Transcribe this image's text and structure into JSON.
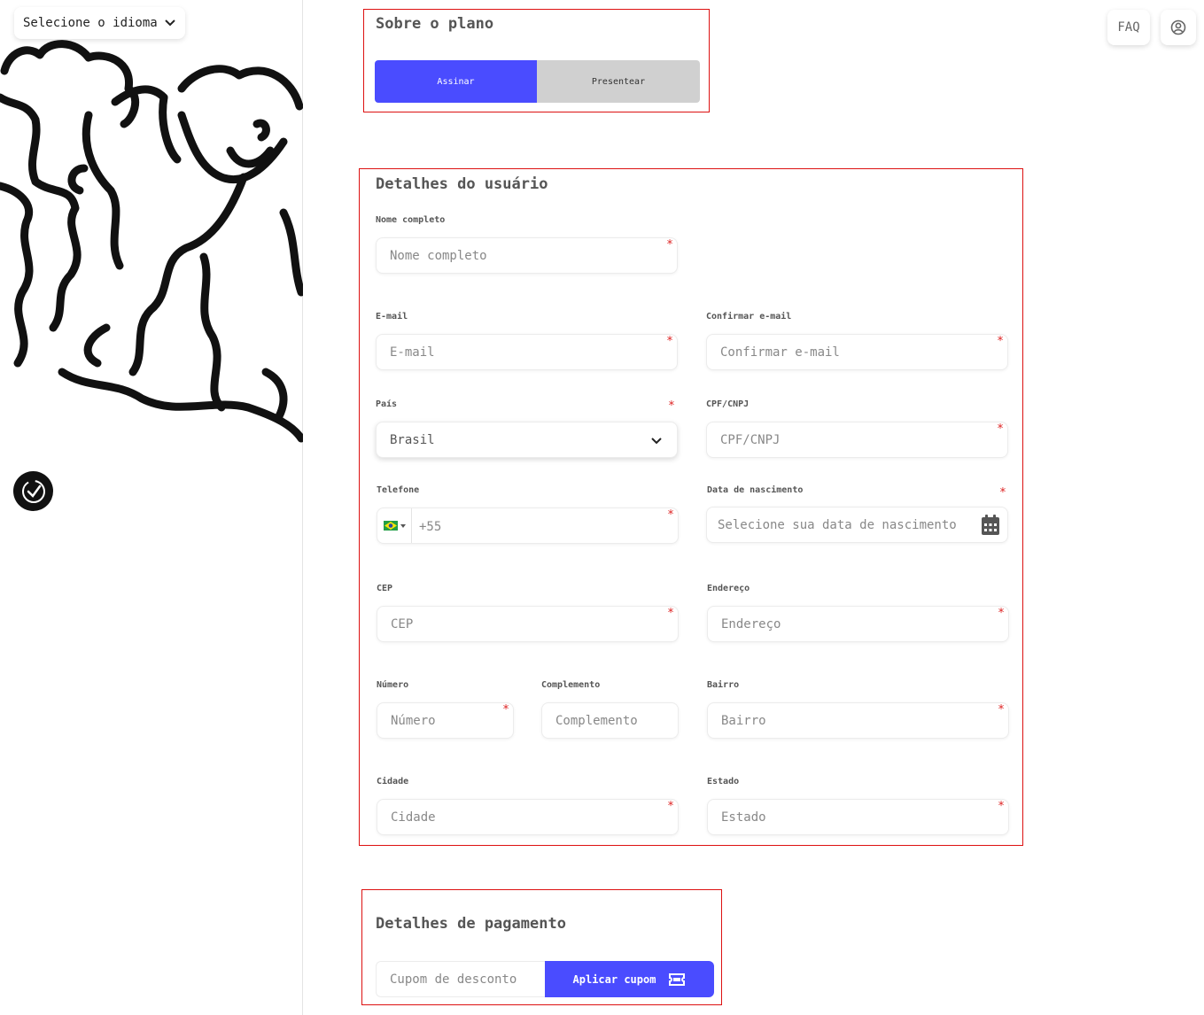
{
  "language_selector": {
    "label": "Selecione o idioma",
    "icon": "chevron-down-icon"
  },
  "header": {
    "faq_label": "FAQ",
    "user_icon": "user-circle-icon"
  },
  "badge": {
    "icon": "checklist-badge-icon"
  },
  "plan": {
    "title": "Sobre o plano",
    "options": [
      "Assinar",
      "Presentear"
    ],
    "selected": "Assinar"
  },
  "user": {
    "title": "Detalhes do usuário",
    "full_name": {
      "label": "Nome completo",
      "placeholder": "Nome completo"
    },
    "email": {
      "label": "E-mail",
      "placeholder": "E-mail"
    },
    "confirm_email": {
      "label": "Confirmar e-mail",
      "placeholder": "Confirmar e-mail"
    },
    "country": {
      "label": "País",
      "value": "Brasil"
    },
    "document": {
      "label": "CPF/CNPJ",
      "placeholder": "CPF/CNPJ"
    },
    "phone": {
      "label": "Telefone",
      "value": "+55",
      "flag": "brazil-flag-icon"
    },
    "birth_date": {
      "label": "Data de nascimento",
      "placeholder": "Selecione sua data de nascimento",
      "icon": "calendar-icon"
    },
    "cep": {
      "label": "CEP",
      "placeholder": "CEP"
    },
    "address": {
      "label": "Endereço",
      "placeholder": "Endereço"
    },
    "number": {
      "label": "Número",
      "placeholder": "Número"
    },
    "complement": {
      "label": "Complemento",
      "placeholder": "Complemento"
    },
    "district": {
      "label": "Bairro",
      "placeholder": "Bairro"
    },
    "city": {
      "label": "Cidade",
      "placeholder": "Cidade"
    },
    "state": {
      "label": "Estado",
      "placeholder": "Estado"
    },
    "required_mark": "*"
  },
  "payment": {
    "title": "Detalhes de pagamento",
    "coupon_placeholder": "Cupom de desconto",
    "apply_label": "Aplicar cupom",
    "apply_icon": "ticket-icon"
  },
  "colors": {
    "accent": "#4a4cff",
    "required": "#dd2222",
    "section_border": "#dd1111"
  }
}
